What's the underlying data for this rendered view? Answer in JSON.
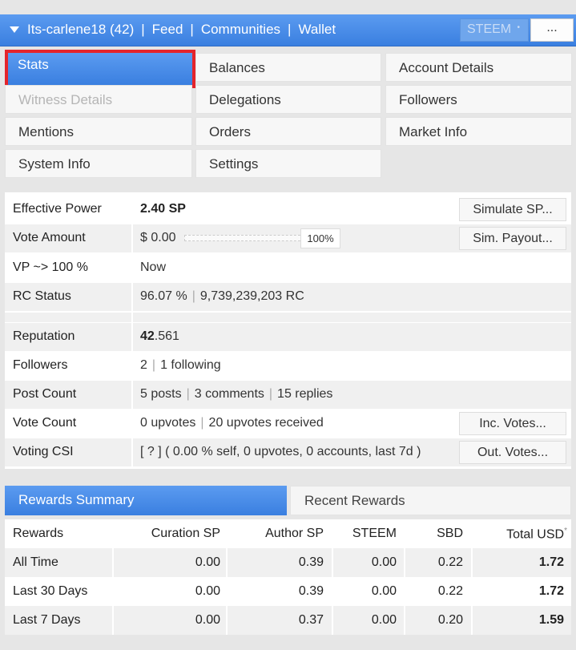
{
  "header": {
    "account": "Its-carlene18 (42)",
    "links": [
      "Feed",
      "Communities",
      "Wallet"
    ],
    "separator": "|",
    "currency": "STEEM",
    "currency_dot": "•",
    "more": "..."
  },
  "menu": {
    "items": [
      "Stats",
      "Balances",
      "Account Details",
      "Witness Details",
      "Delegations",
      "Followers",
      "Mentions",
      "Orders",
      "Market Info",
      "System Info",
      "Settings"
    ],
    "active": "Stats",
    "disabled": [
      "Witness Details"
    ]
  },
  "stats": {
    "effective_power": {
      "label": "Effective Power",
      "value": "2.40 SP",
      "button": "Simulate SP..."
    },
    "vote_amount": {
      "label": "Vote Amount",
      "value": "$ 0.00",
      "percent": "100%",
      "button": "Sim. Payout..."
    },
    "vp": {
      "label": "VP ~> 100 %",
      "value": "Now"
    },
    "rc": {
      "label": "RC Status",
      "percent": "96.07 %",
      "amount": "9,739,239,203 RC"
    },
    "reputation": {
      "label": "Reputation",
      "int": "42",
      "dec": ".561"
    },
    "followers": {
      "label": "Followers",
      "followers": "2",
      "following": "1 following"
    },
    "post_count": {
      "label": "Post Count",
      "posts": "5 posts",
      "comments": "3 comments",
      "replies": "15 replies"
    },
    "vote_count": {
      "label": "Vote Count",
      "upvotes": "0 upvotes",
      "received": "20 upvotes received",
      "button": "Inc. Votes..."
    },
    "voting_csi": {
      "label": "Voting CSI",
      "value": "[ ? ] ( 0.00 % self, 0 upvotes, 0 accounts, last 7d )",
      "button": "Out. Votes..."
    }
  },
  "rewards": {
    "tabs": [
      "Rewards Summary",
      "Recent Rewards"
    ],
    "columns": [
      "Rewards",
      "Curation SP",
      "Author SP",
      "STEEM",
      "SBD",
      "Total USD"
    ],
    "total_marker": "*",
    "rows": [
      {
        "name": "All Time",
        "curation": "0.00",
        "author": "0.39",
        "steem": "0.00",
        "sbd": "0.22",
        "total": "1.72"
      },
      {
        "name": "Last 30 Days",
        "curation": "0.00",
        "author": "0.39",
        "steem": "0.00",
        "sbd": "0.22",
        "total": "1.72"
      },
      {
        "name": "Last 7 Days",
        "curation": "0.00",
        "author": "0.37",
        "steem": "0.00",
        "sbd": "0.20",
        "total": "1.59"
      }
    ]
  },
  "colors": {
    "accent": "#3a7fe0",
    "highlight": "#e4242b"
  }
}
